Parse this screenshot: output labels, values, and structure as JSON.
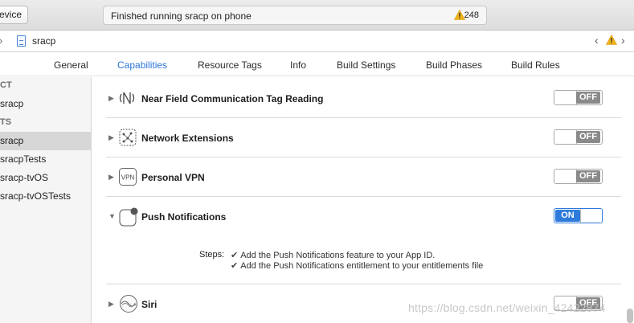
{
  "toolbar": {
    "device_label": "evice",
    "status_text": "Finished running sracp on phone",
    "warning_count": "248",
    "warning_color": "#f3b31a"
  },
  "jumpbar": {
    "file_label": "sracp"
  },
  "tabs": [
    {
      "label": "General"
    },
    {
      "label": "Capabilities"
    },
    {
      "label": "Resource Tags"
    },
    {
      "label": "Info"
    },
    {
      "label": "Build Settings"
    },
    {
      "label": "Build Phases"
    },
    {
      "label": "Build Rules"
    }
  ],
  "active_tab": "Capabilities",
  "sidebar": {
    "project_header": "CT",
    "project_items": [
      "sracp"
    ],
    "targets_header": "TS",
    "target_items": [
      "sracp",
      "sracpTests",
      "sracp-tvOS",
      "sracp-tvOSTests"
    ],
    "selected_target": "sracp"
  },
  "capabilities": [
    {
      "title": "Near Field Communication Tag Reading",
      "icon": "nfc-icon",
      "state": "OFF",
      "expanded": false
    },
    {
      "title": "Network Extensions",
      "icon": "network-extensions-icon",
      "state": "OFF",
      "expanded": false
    },
    {
      "title": "Personal VPN",
      "icon": "vpn-icon",
      "icon_text": "VPN",
      "state": "OFF",
      "expanded": false
    },
    {
      "title": "Push Notifications",
      "icon": "push-notifications-icon",
      "state": "ON",
      "expanded": true
    },
    {
      "title": "Siri",
      "icon": "siri-icon",
      "state": "OFF",
      "expanded": false
    }
  ],
  "push_steps": {
    "label": "Steps:",
    "items": [
      "Add the Push Notifications feature to your App ID.",
      "Add the Push Notifications entitlement to your entitlements file"
    ]
  },
  "watermark": "https://blog.csdn.net/weixin_42422874",
  "colors": {
    "accent": "#2b76d8",
    "switch_on": "#2e7bdb",
    "switch_off": "#8a8a8a"
  }
}
